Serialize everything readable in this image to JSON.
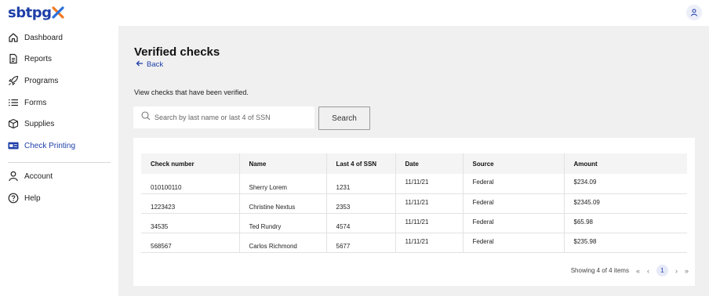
{
  "app": {
    "logo_text": "sbtpg"
  },
  "colors": {
    "accent": "#1f3fa8",
    "logo_x_orange": "#f07a22",
    "logo_x_blue": "#2a6fdb"
  },
  "sidebar": {
    "items": [
      {
        "label": "Dashboard",
        "icon": "home-icon"
      },
      {
        "label": "Reports",
        "icon": "document-icon"
      },
      {
        "label": "Programs",
        "icon": "rocket-icon"
      },
      {
        "label": "Forms",
        "icon": "list-icon"
      },
      {
        "label": "Supplies",
        "icon": "box-icon"
      },
      {
        "label": "Check Printing",
        "icon": "check-printing-icon",
        "active": true
      },
      {
        "label": "Account",
        "icon": "person-icon"
      },
      {
        "label": "Help",
        "icon": "help-icon"
      }
    ]
  },
  "main": {
    "title": "Verified checks",
    "back_label": "Back",
    "description": "View checks that have been verified.",
    "search": {
      "placeholder": "Search by last name or last 4 of SSN",
      "value": "",
      "button_label": "Search"
    },
    "table": {
      "headers": [
        "Check number",
        "Name",
        "Last 4 of SSN",
        "Date",
        "Source",
        "Amount"
      ],
      "rows": [
        [
          "010100110",
          "Sherry Lorem",
          "1231",
          "11/11/21",
          "Federal",
          "$234.09"
        ],
        [
          "1223423",
          "Christine Nextus",
          "2353",
          "11/11/21",
          "Federal",
          "$2345.09"
        ],
        [
          "34535",
          "Ted Rundry",
          "4574",
          "11/11/21",
          "Federal",
          "$65.98"
        ],
        [
          "568567",
          "Carlos Richmond",
          "5677",
          "11/11/21",
          "Federal",
          "$235.98"
        ]
      ]
    },
    "pagination": {
      "summary": "Showing 4 of 4 items",
      "current_page": "1",
      "first": "«",
      "prev": "‹",
      "next": "›",
      "last": "»"
    }
  }
}
